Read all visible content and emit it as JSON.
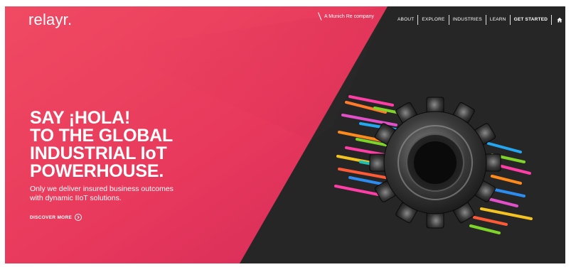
{
  "brand": {
    "logo": "relayr."
  },
  "header": {
    "parent_company": "A Munich Re company",
    "nav": [
      {
        "label": "ABOUT"
      },
      {
        "label": "EXPLORE"
      },
      {
        "label": "INDUSTRIES"
      },
      {
        "label": "LEARN"
      },
      {
        "label": "GET STARTED"
      }
    ],
    "icons": [
      "home-icon",
      "globe-icon"
    ]
  },
  "hero": {
    "headline": [
      "SAY ¡HOLA!",
      "TO THE GLOBAL",
      "INDUSTRIAL IoT",
      "POWERHOUSE."
    ],
    "subline": [
      "Only we deliver insured business outcomes",
      "with dynamic IIoT solutions."
    ],
    "cta_label": "DISCOVER MORE",
    "cta_icon": "chevron-right-icon"
  },
  "colors": {
    "accent": "#e8395c",
    "dark": "#262626",
    "text": "#ffffff"
  }
}
